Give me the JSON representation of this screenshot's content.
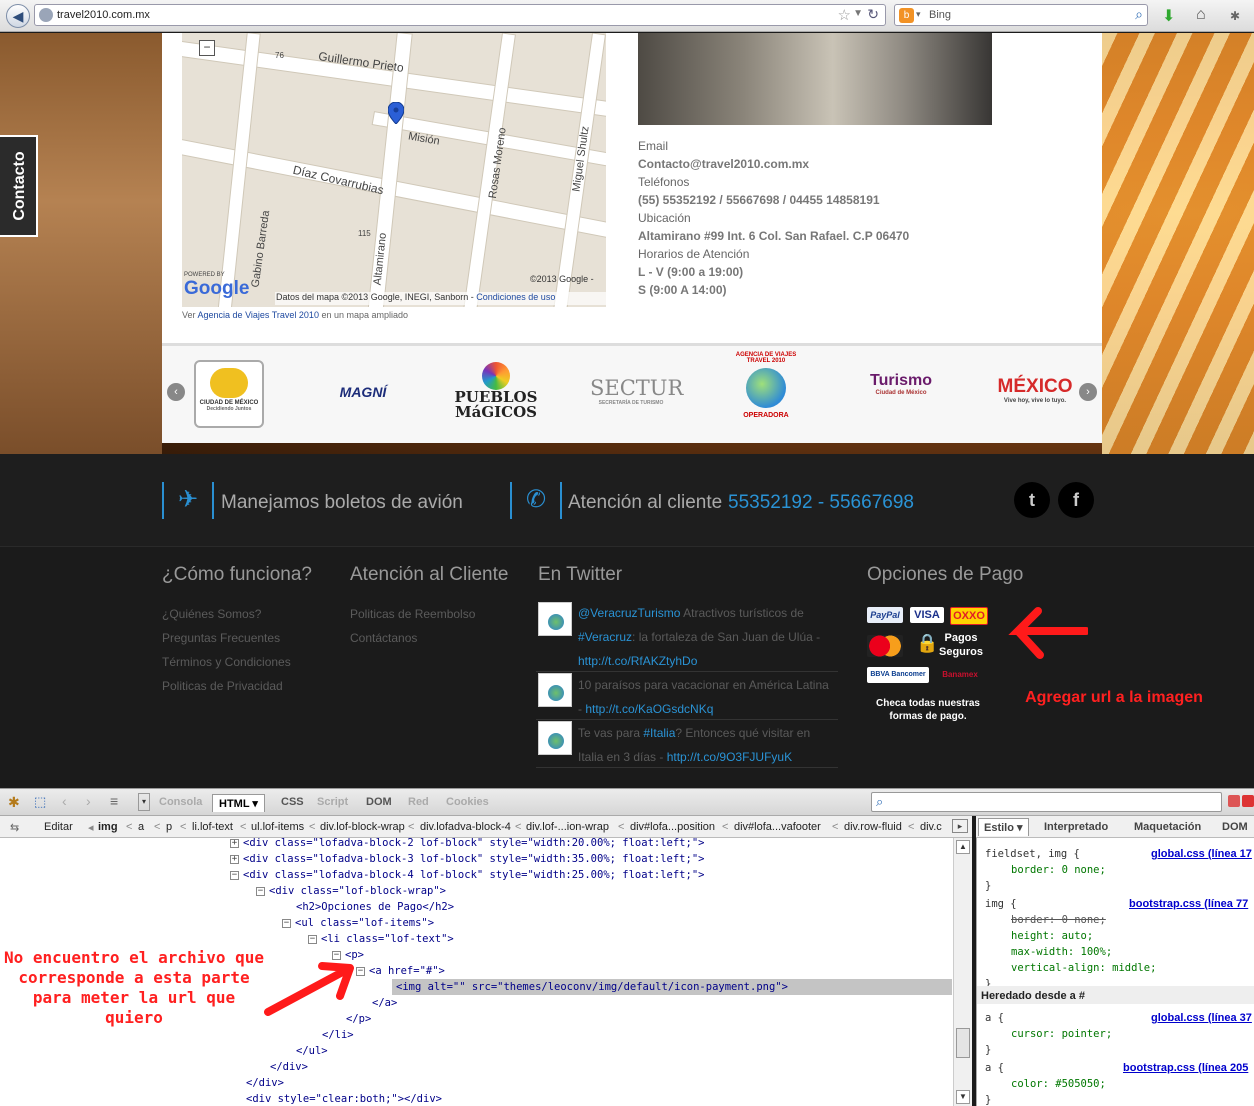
{
  "browser": {
    "url": "travel2010.com.mx",
    "search_engine": "Bing"
  },
  "page": {
    "contact_tab": "Contacto",
    "map": {
      "streets": [
        "Guillermo Prieto",
        "Misión",
        "Díaz Covarrubias",
        "Rosas Moreno",
        "Miguel Shultz",
        "Gabino Barreda",
        "Altamirano",
        "76",
        "115"
      ],
      "copyright": "©2013 Google -",
      "credit_prefix": "Datos del mapa ©2013 Google, INEGI, Sanborn -",
      "credit_link": "Condiciones de uso",
      "powered_by": "POWERED BY",
      "google": "Google",
      "view_prefix": "Ver",
      "view_link": "Agencia de Viajes Travel 2010",
      "view_suffix": "en un mapa ampliado"
    },
    "info": {
      "email_label": "Email",
      "email": "Contacto@travel2010.com.mx",
      "phones_label": "Teléfonos",
      "phones": "(55) 55352192 / 55667698 / 04455 14858191",
      "location_label": "Ubicación",
      "location": "Altamirano #99 Int. 6 Col. San Rafael. C.P 06470",
      "hours_label": "Horarios de Atención",
      "hours_week": "L - V (9:00 a 19:00)",
      "hours_sat": "S (9:00 A 14:00)"
    },
    "logos": {
      "cdmx": "CIUDAD DE MÉXICO",
      "cdmx_sub": "Decidiendo Juntos",
      "magni": "MAGNÍ",
      "pueblos": "PUEBLOS MáGICOS",
      "sectur": "SECTUR",
      "sectur_sub": "SECRETARÍA DE TURISMO",
      "operadora_top": "AGENCIA DE VIAJES TRAVEL 2010",
      "operadora_bottom": "OPERADORA",
      "turismo": "Turismo",
      "turismo_sub": "Ciudad de México",
      "mexico": "MÉXICO",
      "mexico_sub": "Vive hoy, vive lo tuyo."
    },
    "footer_top": {
      "flights": "Manejamos boletos de avión",
      "service": "Atención al cliente",
      "phones": "55352192 - 55667698"
    },
    "footer": {
      "col1_title": "¿Cómo funciona?",
      "col1_links": [
        "¿Quiénes Somos?",
        "Preguntas Frecuentes",
        "Términos y Condiciones",
        "Politicas de Privacidad"
      ],
      "col2_title": "Atención al Cliente",
      "col2_links": [
        "Politicas de Reembolso",
        "Contáctanos"
      ],
      "col3_title": "En Twitter",
      "tweets": [
        {
          "line1_link": "@VeracruzTurismo",
          "line1_text": " Atractivos turísticos de",
          "line2_link": "#Veracruz",
          "line2_text": ": la fortaleza de San Juan de Ulúa -",
          "line3_link": "http://t.co/RfAKZtyhDo"
        },
        {
          "line1_text": "10 paraísos para vacacionar en América Latina",
          "line2_text": "- ",
          "line2_link": "http://t.co/KaOGsdcNKq"
        },
        {
          "line1_text": "Te vas para ",
          "line1_link": "#Italia",
          "line1_text2": "? Entonces qué visitar en",
          "line2_text": "Italia en 3 días - ",
          "line2_link": "http://t.co/9O3FJUFyuK"
        }
      ],
      "col4_title": "Opciones de Pago",
      "pay_paypal": "PayPal",
      "pay_visa": "VISA",
      "pay_oxxo": "OXXO",
      "pay_safe": "Pagos Seguros",
      "pay_bancomer": "BBVA Bancomer",
      "pay_banamex": "Banamex",
      "pay_caption": "Checa todas nuestras formas de pago."
    },
    "annotations": {
      "right": "Agregar url a la imagen",
      "left": "No encuentro el archivo que corresponde a esta parte para meter la url que quiero"
    }
  },
  "firebug": {
    "tabs": [
      "Consola",
      "HTML",
      "CSS",
      "Script",
      "DOM",
      "Red",
      "Cookies"
    ],
    "edit": "Editar",
    "breadcrumbs": [
      "img",
      "a",
      "p",
      "li.lof-text",
      "ul.lof-items",
      "div.lof-block-wrap",
      "div.lofadva-block-4",
      "div.lof-...ion-wrap",
      "div#lofa...position",
      "div#lofa...vafooter",
      "div.row-fluid",
      "div.c"
    ],
    "side_tabs": [
      "Estilo",
      "Interpretado",
      "Maquetación",
      "DOM"
    ],
    "html_lines": [
      "<div class=\"lofadva-block-2 lof-block\" style=\"width:20.00%; float:left;\">",
      "<div class=\"lofadva-block-3 lof-block\" style=\"width:35.00%; float:left;\">",
      "<div class=\"lofadva-block-4 lof-block\" style=\"width:25.00%; float:left;\">",
      "<div class=\"lof-block-wrap\">",
      "<h2>Opciones de Pago</h2>",
      "<ul class=\"lof-items\">",
      "<li class=\"lof-text\">",
      "<p>",
      "<a href=\"#\">",
      "<img alt=\"\" src=\"themes/leoconv/img/default/icon-payment.png\">",
      "</a>",
      "</p>",
      "</li>",
      "</ul>",
      "</div>",
      "</div>",
      "<div style=\"clear:both;\"></div>"
    ],
    "css": {
      "rule1_sel": "fieldset, img {",
      "rule1_src": "global.css (línea 17",
      "rule1_p1": "border: 0 none;",
      "rule2_sel": "img {",
      "rule2_src": "bootstrap.css (línea 77",
      "rule2_p1": "border: 0 none;",
      "rule2_p2": "height: auto;",
      "rule2_p3": "max-width: 100%;",
      "rule2_p4": "vertical-align: middle;",
      "inherited": "Heredado desde a #",
      "rule3_sel": "a {",
      "rule3_src": "global.css (línea 37",
      "rule3_p1": "cursor: pointer;",
      "rule4_sel": "a {",
      "rule4_src": "bootstrap.css (línea 205",
      "rule4_p1": "color: #505050;",
      "close": "}"
    }
  },
  "colors": {
    "accent_blue": "#2a93d5",
    "annotation_red": "#ff2020"
  }
}
